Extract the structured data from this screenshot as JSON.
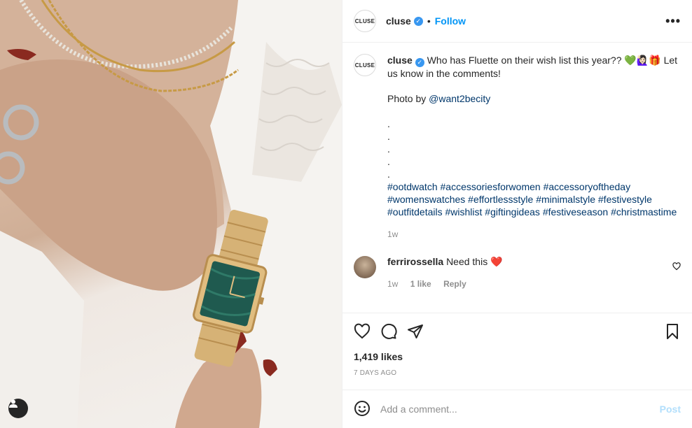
{
  "photo": {
    "description_icon": "user-silhouette-icon"
  },
  "header": {
    "avatar_text": "CLUSE",
    "username": "cluse",
    "separator": "•",
    "follow_label": "Follow",
    "more_label": "•••"
  },
  "caption": {
    "avatar_text": "CLUSE",
    "username": "cluse",
    "text": "Who has Fluette on their wish list this year?? 💚🙋🏻‍♀️🎁 Let us know in the comments!",
    "photo_by_prefix": "Photo by ",
    "photo_by_handle": "@want2becity",
    "dots": [
      ".",
      ".",
      ".",
      ".",
      "."
    ],
    "hashtags": [
      "#ootdwatch",
      "#accessoriesforwomen",
      "#accessoryoftheday",
      "#womenswatches",
      "#effortlessstyle",
      "#minimalstyle",
      "#festivestyle",
      "#outfitdetails",
      "#wishlist",
      "#giftingideas",
      "#festiveseason",
      "#christmastime"
    ],
    "time": "1w"
  },
  "comment": {
    "username": "ferrirossella",
    "text": "Need this ❤️",
    "time": "1w",
    "likes": "1 like",
    "reply_label": "Reply"
  },
  "actions": {
    "likes": "1,419 likes",
    "date": "7 DAYS AGO"
  },
  "add_comment": {
    "placeholder": "Add a comment...",
    "post_label": "Post"
  },
  "colors": {
    "accent": "#0095f6",
    "verified": "#3897f0",
    "post_disabled": "#b2dffc",
    "muted": "#8e8e8e"
  }
}
